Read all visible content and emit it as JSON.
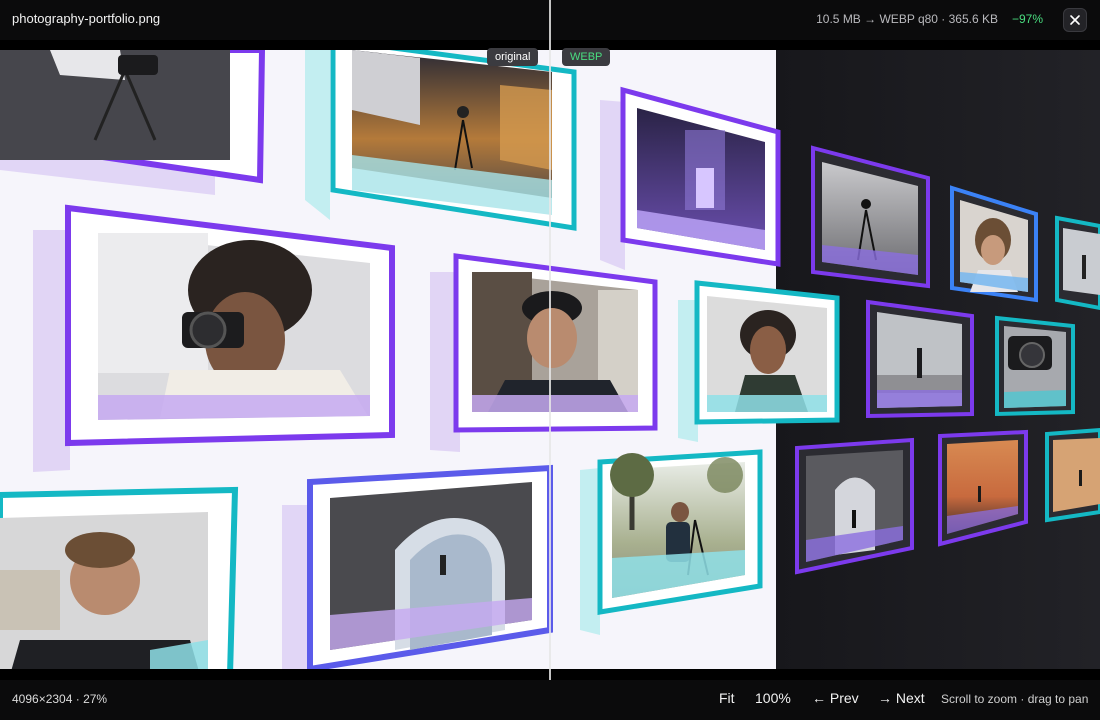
{
  "header": {
    "filename": "photography-portfolio.png",
    "stats": "10.5 MB → WEBP q80 · 365.6 KB",
    "saving": "−97%",
    "close_symbol": "✕"
  },
  "compare": {
    "left_label": "original",
    "right_label": "WEBP"
  },
  "footer": {
    "dimensions": "4096×2304 · 27%",
    "fit_label": "Fit",
    "zoom_label": "100%",
    "prev_label": "← Prev",
    "next_label": "→ Next",
    "hint": "Scroll to zoom · drag to pan"
  },
  "colors": {
    "purple": "#7c3aed",
    "teal": "#14b8c4",
    "blue": "#3b82f6",
    "saving_green": "#4ade80",
    "dark_bg": "#1b1b1f"
  }
}
